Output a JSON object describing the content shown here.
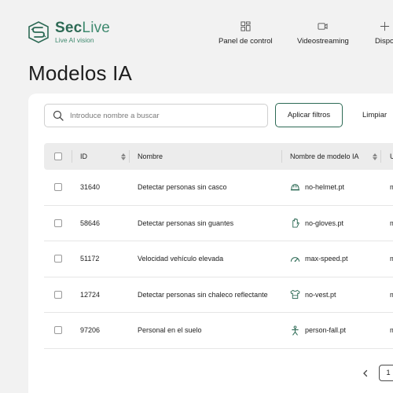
{
  "brand": {
    "name_bold": "Sec",
    "name_light": "Live",
    "tagline": "Live AI vision"
  },
  "nav": [
    {
      "label": "Panel de control",
      "icon": "dashboard-icon"
    },
    {
      "label": "Videostreaming",
      "icon": "video-camera-icon"
    },
    {
      "label": "Dispo",
      "icon": "devices-icon"
    }
  ],
  "page": {
    "title": "Modelos IA"
  },
  "toolbar": {
    "search_placeholder": "Introduce nombre a buscar",
    "apply_label": "Aplicar filtros",
    "clear_label": "Limpiar"
  },
  "table": {
    "columns": {
      "id": "ID",
      "name": "Nombre",
      "model": "Nombre de modelo IA",
      "extra": "U"
    },
    "rows": [
      {
        "id": "31640",
        "name": "Detectar personas sin casco",
        "model": "no-helmet.pt",
        "model_icon": "helmet-icon",
        "extra": "m"
      },
      {
        "id": "58646",
        "name": "Detectar personas sin guantes",
        "model": "no-gloves.pt",
        "model_icon": "glove-icon",
        "extra": "m"
      },
      {
        "id": "51172",
        "name": "Velocidad vehículo elevada",
        "model": "max-speed.pt",
        "model_icon": "speedometer-icon",
        "extra": "m"
      },
      {
        "id": "12724",
        "name": "Detectar personas sin chaleco reflectante",
        "model": "no-vest.pt",
        "model_icon": "vest-icon",
        "extra": "m"
      },
      {
        "id": "97206",
        "name": "Personal en el suelo",
        "model": "person-fall.pt",
        "model_icon": "person-fall-icon",
        "extra": "m"
      }
    ]
  },
  "pagination": {
    "current_page": "1"
  },
  "colors": {
    "brand": "#2d6a55",
    "background": "#f2f2f2",
    "card": "#ffffff",
    "header_row": "#ececec"
  }
}
